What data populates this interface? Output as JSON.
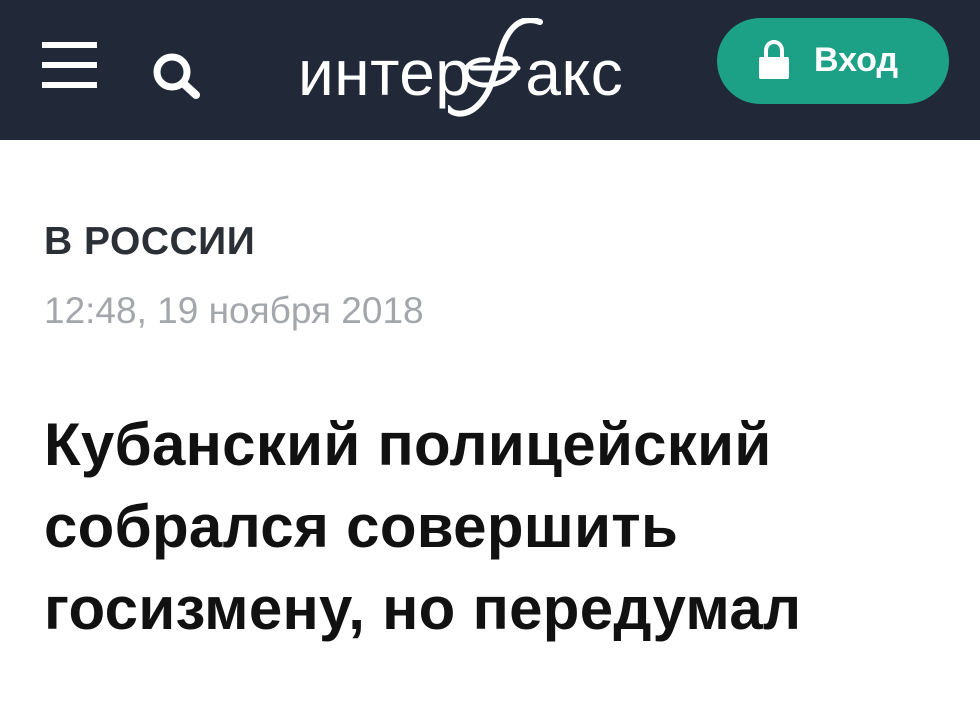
{
  "header": {
    "menu_icon": "hamburger-menu-icon",
    "search_icon": "search-icon",
    "logo": {
      "text_left": "интер",
      "text_right": "акс",
      "stylized_letter": "ф"
    },
    "login": {
      "icon": "lock-icon",
      "label": "Вход"
    },
    "colors": {
      "background": "#212838",
      "login_button": "#1ca086"
    }
  },
  "article": {
    "section": "В РОССИИ",
    "timestamp": "12:48, 19 ноября 2018",
    "headline": "Кубанский полицейский собрался совершить госизмену, но передумал"
  }
}
